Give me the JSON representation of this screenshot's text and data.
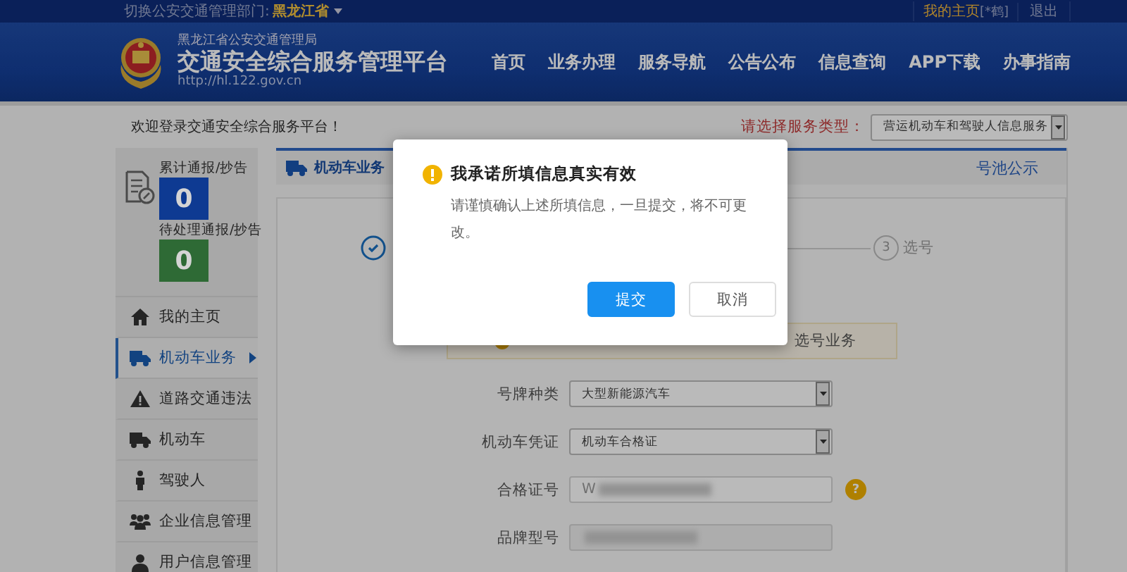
{
  "top_bar": {
    "switch_label": "切换公安交通管理部门:",
    "region": "黑龙江省",
    "user_link": "我的主页",
    "user_name": "[*鹤]",
    "logout": "退出"
  },
  "header": {
    "agency": "黑龙江省公安交通管理局",
    "title": "交通安全综合服务管理平台",
    "url": "http://hl.122.gov.cn",
    "nav": [
      "首页",
      "业务办理",
      "服务导航",
      "公告公布",
      "信息查询",
      "APP下载",
      "办事指南"
    ]
  },
  "welcome": "欢迎登录交通安全综合服务平台！",
  "service_type": {
    "label": "请选择服务类型：",
    "value": "营运机动车和驾驶人信息服务"
  },
  "stats": [
    {
      "label": "累计通报/抄告",
      "count": "0",
      "color": "#0e3a92"
    },
    {
      "label": "待处理通报/抄告",
      "count": "0",
      "color": "#2e6a35"
    }
  ],
  "sidebar": {
    "items": [
      {
        "label": "我的主页",
        "selected": false
      },
      {
        "label": "机动车业务",
        "selected": true
      },
      {
        "label": "道路交通违法",
        "selected": false
      },
      {
        "label": "机动车",
        "selected": false
      },
      {
        "label": "驾驶人",
        "selected": false
      },
      {
        "label": "企业信息管理",
        "selected": false
      },
      {
        "label": "用户信息管理",
        "selected": false
      }
    ]
  },
  "panel": {
    "tab": "机动车业务",
    "pool_link": "号池公示",
    "steps": [
      {
        "done": true
      },
      {
        "number": "3",
        "label": "选号",
        "done": false
      }
    ],
    "notice": "选号业务",
    "form": [
      {
        "kind": "select",
        "label": "号牌种类",
        "value": "大型新能源汽车"
      },
      {
        "kind": "select",
        "label": "机动车凭证",
        "value": "机动车合格证"
      },
      {
        "kind": "input",
        "label": "合格证号",
        "value": "W",
        "redacted": true,
        "help": "?"
      },
      {
        "kind": "input",
        "label": "品牌型号",
        "redacted": true,
        "disabled": true
      }
    ]
  },
  "dialog": {
    "title": "我承诺所填信息真实有效",
    "message": "请谨慎确认上述所填信息，一旦提交，将不可更改。",
    "buttons": [
      {
        "label": "提交",
        "primary": true
      },
      {
        "label": "取消",
        "primary": false
      }
    ]
  }
}
